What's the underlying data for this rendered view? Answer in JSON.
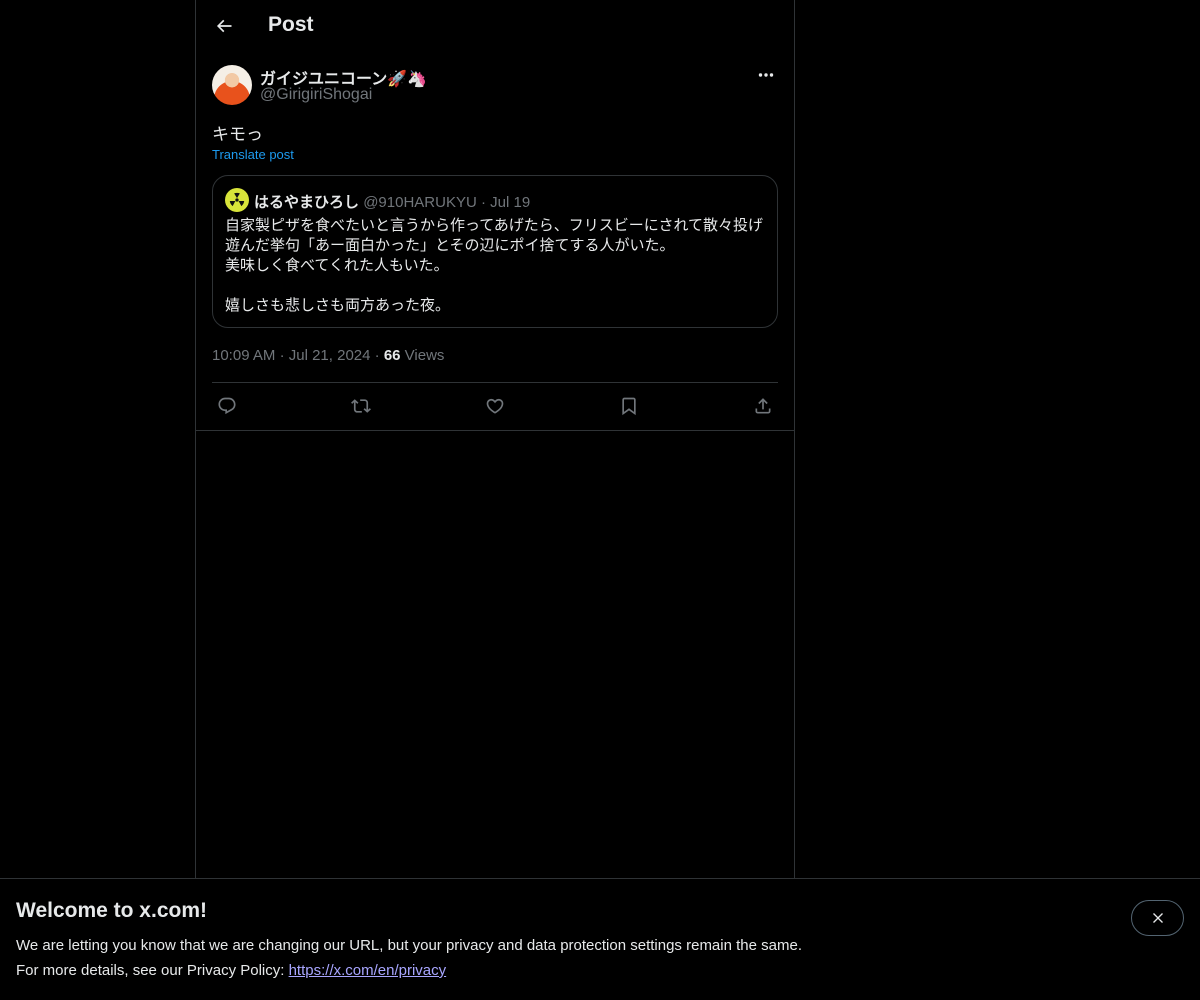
{
  "header": {
    "title": "Post",
    "back_icon": "arrow-left-icon"
  },
  "post": {
    "author_name": "ガイジユニコーン🚀🦄",
    "author_handle": "@GirigiriShogai",
    "text": "キモっ",
    "translate_label": "Translate post",
    "time": "10:09 AM",
    "date": "Jul 21, 2024",
    "views_count": "66",
    "views_label": "Views"
  },
  "quote": {
    "author_name": "はるやまひろし",
    "author_handle": "@910HARUKYU",
    "separator": "·",
    "date": "Jul 19",
    "body": "自家製ピザを食べたいと言うから作ってあげたら、フリスビーにされて散々投げ遊んだ挙句「あー面白かった」とその辺にポイ捨てする人がいた。\n美味しく食べてくれた人もいた。\n\n嬉しさも悲しさも両方あった夜。"
  },
  "meta_separator": "·",
  "actions": [
    "reply-icon",
    "repost-icon",
    "like-icon",
    "bookmark-icon",
    "share-icon"
  ],
  "banner": {
    "title": "Welcome to x.com!",
    "line1": "We are letting you know that we are changing our URL, but your privacy and data protection settings remain the same.",
    "line2_prefix": "For more details, see our Privacy Policy: ",
    "link": "https://x.com/en/privacy"
  },
  "colors": {
    "background": "#000000",
    "text": "#e7e9ea",
    "muted": "#71767b",
    "accent": "#1d9bf0",
    "border": "#2f3336",
    "link": "#a8a6ff"
  }
}
